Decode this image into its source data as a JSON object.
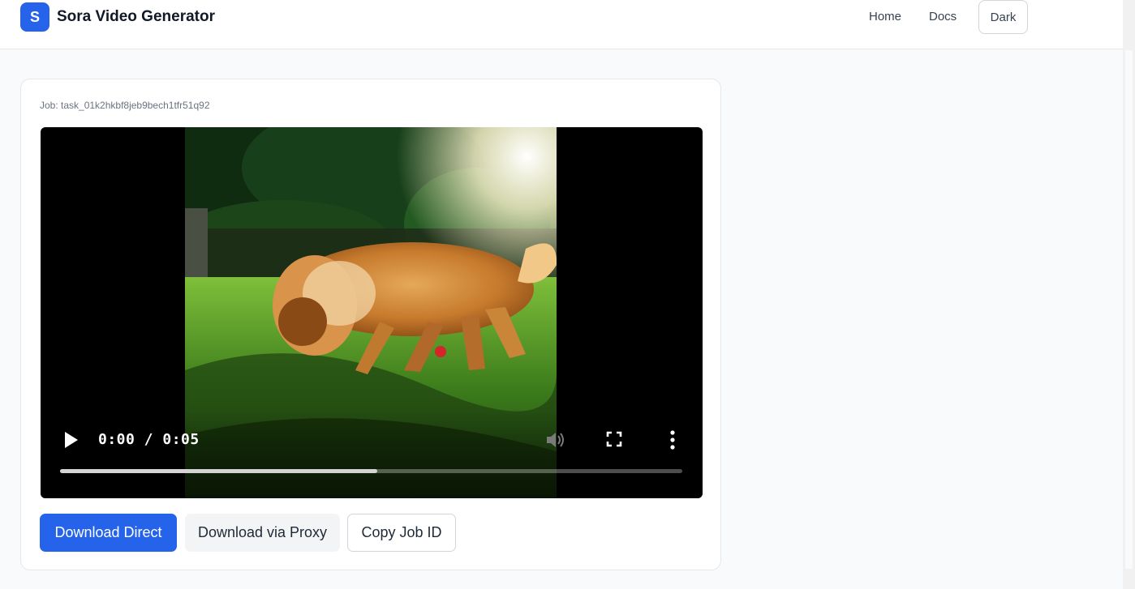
{
  "app": {
    "logo_letter": "S",
    "title": "Sora Video Generator"
  },
  "nav": {
    "home": "Home",
    "docs": "Docs",
    "theme_toggle": "Dark"
  },
  "job": {
    "label": "Job: task_01k2hkbf8jeb9bech1tfr51q92"
  },
  "player": {
    "time_display": "0:00 / 0:05",
    "progress_fraction": 0.51,
    "icons": [
      "play-icon",
      "volume-icon",
      "fullscreen-icon",
      "more-options-icon"
    ]
  },
  "actions": {
    "download_direct": "Download Direct",
    "download_proxy": "Download via Proxy",
    "copy_job_id": "Copy Job ID"
  },
  "colors": {
    "accent": "#2563eb",
    "background": "#f9fafb",
    "card": "#ffffff"
  }
}
